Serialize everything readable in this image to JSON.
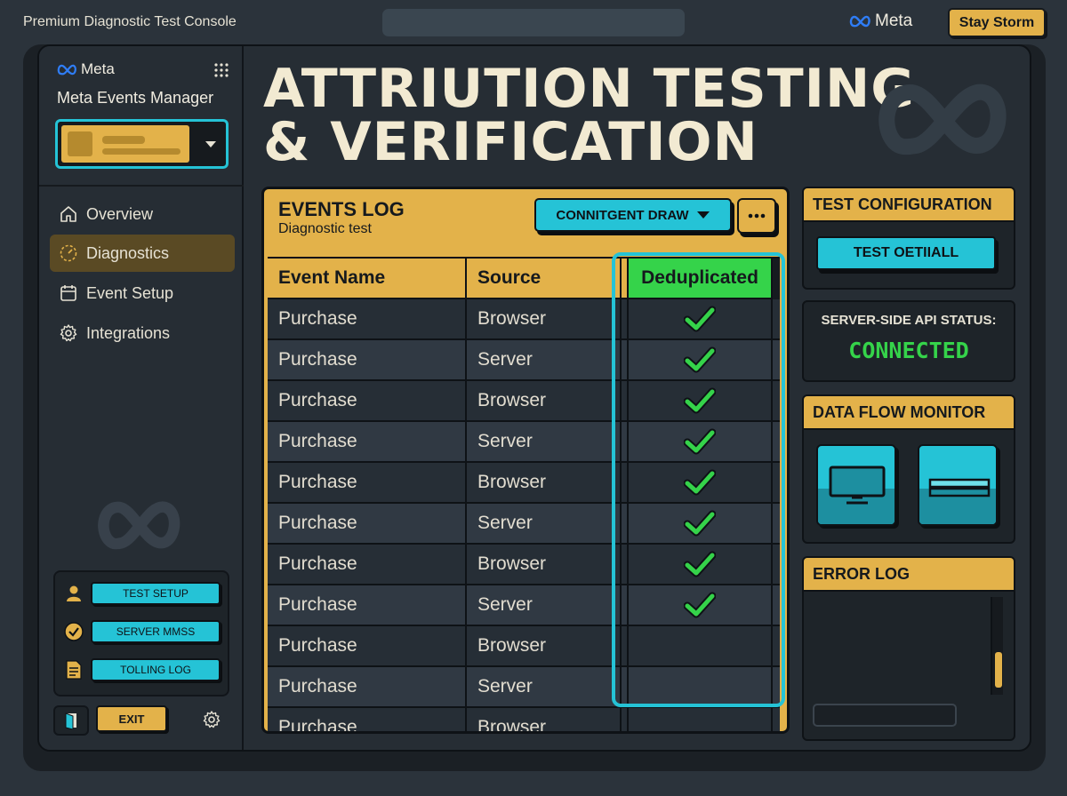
{
  "topbar": {
    "app_title": "Premium Diagnostic Test Console",
    "brand": "Meta",
    "user_button": "Stay Storm"
  },
  "sidebar": {
    "brand": "Meta",
    "title": "Meta Events Manager",
    "nav": [
      {
        "label": "Overview",
        "icon": "home-icon",
        "active": false
      },
      {
        "label": "Diagnostics",
        "icon": "gauge-icon",
        "active": true
      },
      {
        "label": "Event Setup",
        "icon": "calendar-icon",
        "active": false
      },
      {
        "label": "Integrations",
        "icon": "gear-icon",
        "active": false
      }
    ],
    "panel_buttons": [
      "TEST SETUP",
      "SERVER MMSS",
      "TOLLING LOG"
    ],
    "exit_label": "EXIT"
  },
  "main": {
    "title_line1": "ATTRIUTION TESTING",
    "title_line2": "& VERIFICATION"
  },
  "events_log": {
    "title": "EVENTS LOG",
    "subtitle": "Diagnostic test",
    "filter_label": "CONNITGENT DRAW",
    "columns": [
      "Event Name",
      "Source",
      "Deduplicated"
    ],
    "rows": [
      {
        "event": "Purchase",
        "source": "Browser",
        "dedup": true
      },
      {
        "event": "Purchase",
        "source": "Server",
        "dedup": true
      },
      {
        "event": "Purchase",
        "source": "Browser",
        "dedup": true
      },
      {
        "event": "Purchase",
        "source": "Server",
        "dedup": true
      },
      {
        "event": "Purchase",
        "source": "Browser",
        "dedup": true
      },
      {
        "event": "Purchase",
        "source": "Server",
        "dedup": true
      },
      {
        "event": "Purchase",
        "source": "Browser",
        "dedup": true
      },
      {
        "event": "Purchase",
        "source": "Server",
        "dedup": true
      },
      {
        "event": "Purchase",
        "source": "Browser",
        "dedup": false
      },
      {
        "event": "Purchase",
        "source": "Server",
        "dedup": false
      },
      {
        "event": "Purchase",
        "source": "Browser",
        "dedup": false
      }
    ]
  },
  "test_config": {
    "title": "TEST CONFIGURATION",
    "button": "TEST OΕTIIALL"
  },
  "api_status": {
    "label": "SERVER-SIDE API STATUS:",
    "value": "CONNECTED"
  },
  "data_flow": {
    "title": "DATA FLOW MONITOR",
    "tiles": [
      "monitor-icon",
      "server-icon"
    ]
  },
  "error_log": {
    "title": "ERROR LOG"
  },
  "colors": {
    "accent_yellow": "#e3b24a",
    "accent_cyan": "#25c3d6",
    "status_green": "#35d34a",
    "background": "#2b333b"
  }
}
